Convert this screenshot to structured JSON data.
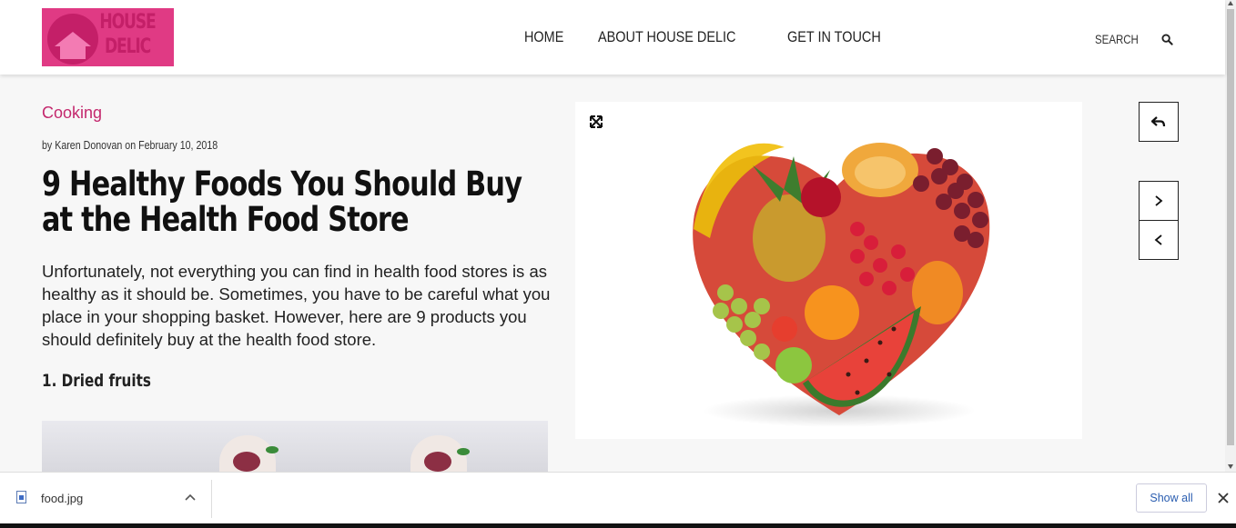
{
  "header": {
    "logo_line1": "HOUSE",
    "logo_line2": "DELIC",
    "nav": [
      "HOME",
      "ABOUT HOUSE DELIC",
      "GET IN TOUCH"
    ],
    "search_label": "SEARCH"
  },
  "article": {
    "category": "Cooking",
    "byline": "by Karen Donovan on February 10, 2018",
    "title": "9 Healthy Foods You Should Buy at the Health Food Store",
    "intro": "Unfortunately, not everything you can find in health food stores is as healthy as it should be. Sometimes, you have to be careful what you place in your shopping basket. However, here are 9 products you should definitely buy at the health food store.",
    "subhead": "1. Dried fruits"
  },
  "download_bar": {
    "file_name": "food.jpg",
    "show_all": "Show all"
  },
  "colors": {
    "accent": "#c4286d",
    "logo_bg": "#e03a84"
  },
  "icons": [
    "search-icon",
    "expand-icon",
    "reply-icon",
    "chevron-right-icon",
    "chevron-left-icon",
    "file-icon",
    "chevron-up-icon",
    "close-icon"
  ]
}
